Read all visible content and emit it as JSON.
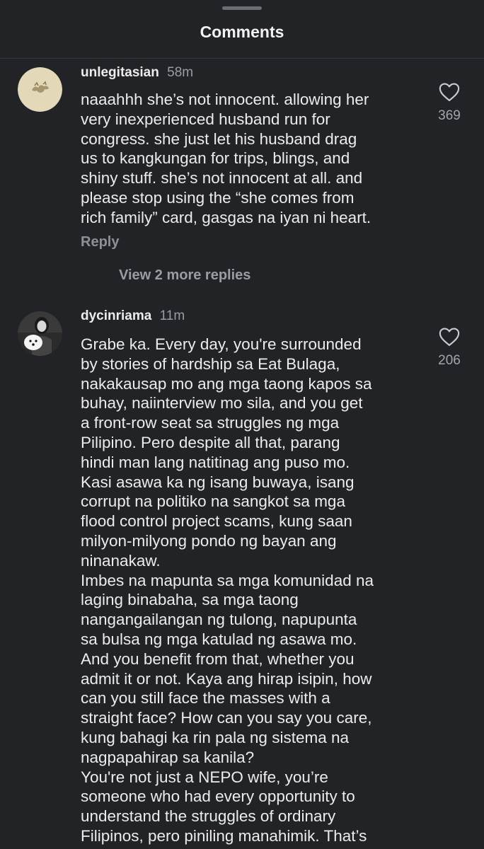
{
  "sheet": {
    "title": "Comments"
  },
  "comments": [
    {
      "username": "unlegitasian",
      "time": "58m",
      "lines": [
        "naaahhh she’s not innocent. allowing her",
        "very inexperienced husband run for",
        "congress. she just let his husband drag",
        "us to kangkungan for trips, blings, and",
        "shiny stuff. she’s not innocent at all. and",
        "please stop using the “she comes from",
        "rich family” card, gasgas na iyan ni heart."
      ],
      "likes": "369",
      "reply_label": "Reply",
      "view_replies_label": "View 2 more replies"
    },
    {
      "username": "dycinriama",
      "time": "11m",
      "lines": [
        "Grabe ka. Every day, you're surrounded",
        "by stories of hardship sa Eat Bulaga,",
        "nakakausap mo ang mga taong kapos sa",
        "buhay, naiinterview mo sila, and you get",
        "a front-row seat sa struggles ng mga",
        "Pilipino. Pero despite all that, parang",
        "hindi man lang natitinag ang puso mo.",
        "Kasi asawa ka ng isang buwaya, isang",
        "corrupt na politiko na sangkot sa mga",
        "flood control project scams, kung saan",
        "milyon-milyong pondo ng bayan ang",
        "ninanakaw.",
        "Imbes na mapunta sa mga komunidad na",
        "laging binabaha, sa mga taong",
        "nangangailangan ng tulong, napupunta",
        "sa bulsa ng mga katulad ng asawa mo.",
        "And you benefit from that, whether you",
        "admit it or not. Kaya ang hirap isipin, how",
        "can you still face the masses with a",
        "straight face? How can you say you care,",
        "kung bahagi ka rin pala ng sistema na",
        "nagpapahirap sa kanila?",
        "You're not just a NEPO wife, you’re",
        "someone who had every opportunity to",
        "understand the struggles of ordinary",
        "Filipinos, pero piniling manahimik. That’s"
      ],
      "likes": "206"
    }
  ],
  "icons": {
    "like": "heart-outline-icon"
  },
  "colors": {
    "background": "#222327",
    "text": "#ececee",
    "muted": "#9a9ca2"
  }
}
